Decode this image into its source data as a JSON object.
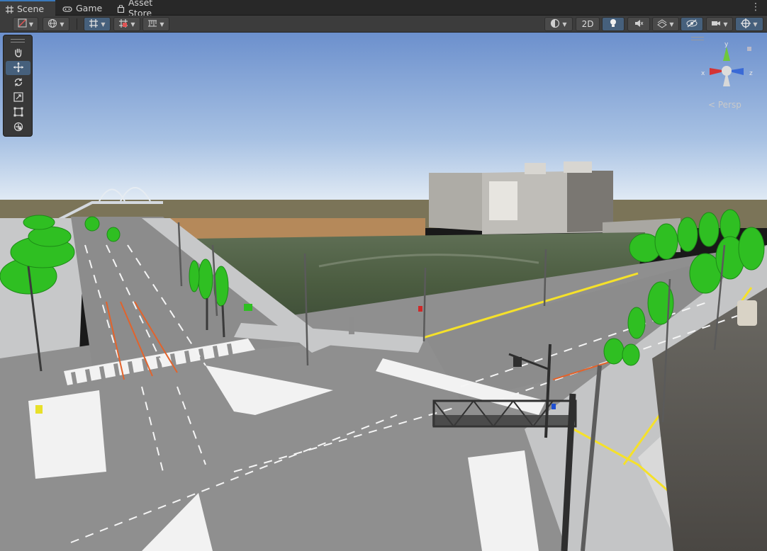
{
  "tabs": [
    {
      "label": "Scene",
      "icon": "grid-hash-icon",
      "active": true
    },
    {
      "label": "Game",
      "icon": "gamepad-icon",
      "active": false
    },
    {
      "label": "Asset Store",
      "icon": "shopping-bag-icon",
      "active": false
    }
  ],
  "toolbar": {
    "left_buttons": [
      "draw-mode-icon",
      "global-icon",
      "grid-snap-icon",
      "increment-snap-icon",
      "ruler-icon"
    ],
    "shading_mode_icon": "shading-sphere-icon",
    "mode_2d_label": "2D",
    "right_buttons": [
      "lighting-icon",
      "audio-mute-icon",
      "effects-icon",
      "hidden-objects-icon",
      "camera-icon",
      "gizmos-icon"
    ]
  },
  "tool_palette": [
    "hand-tool-icon",
    "move-tool-icon",
    "rotate-tool-icon",
    "scale-tool-icon",
    "rect-tool-icon",
    "transform-tool-icon"
  ],
  "active_tool": "move-tool-icon",
  "gizmo": {
    "projection_label": "< Persp",
    "axis_y": "y",
    "axis_x": "x",
    "axis_z": "z"
  },
  "colors": {
    "accent": "#3a79bb",
    "active_button": "#46607c",
    "sky_top": "#6f93cf",
    "sky_horizon": "#e9f0f7",
    "road": "#8f8f8f",
    "tree": "#2fbf22",
    "curb_line": "#f5e12a"
  }
}
